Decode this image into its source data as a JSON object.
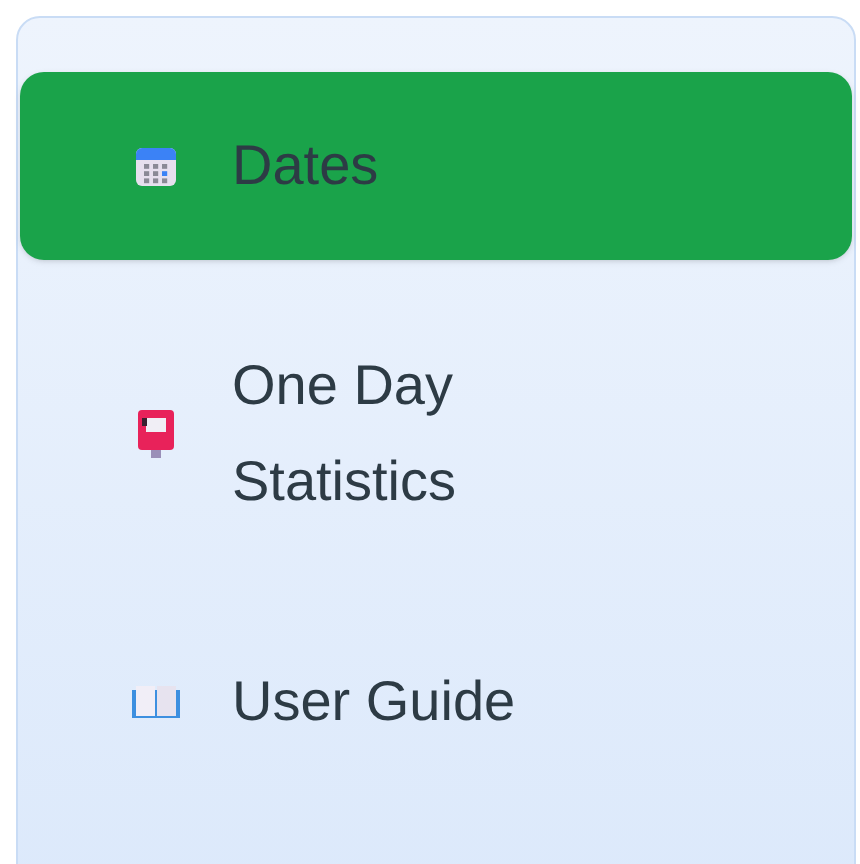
{
  "sidebar": {
    "items": [
      {
        "label": "Dates",
        "kind": "calendar",
        "selected": true
      },
      {
        "label": "One Day Statistics",
        "kind": "postbox",
        "selected": false
      },
      {
        "label": "User Guide",
        "kind": "book",
        "selected": false
      }
    ]
  }
}
